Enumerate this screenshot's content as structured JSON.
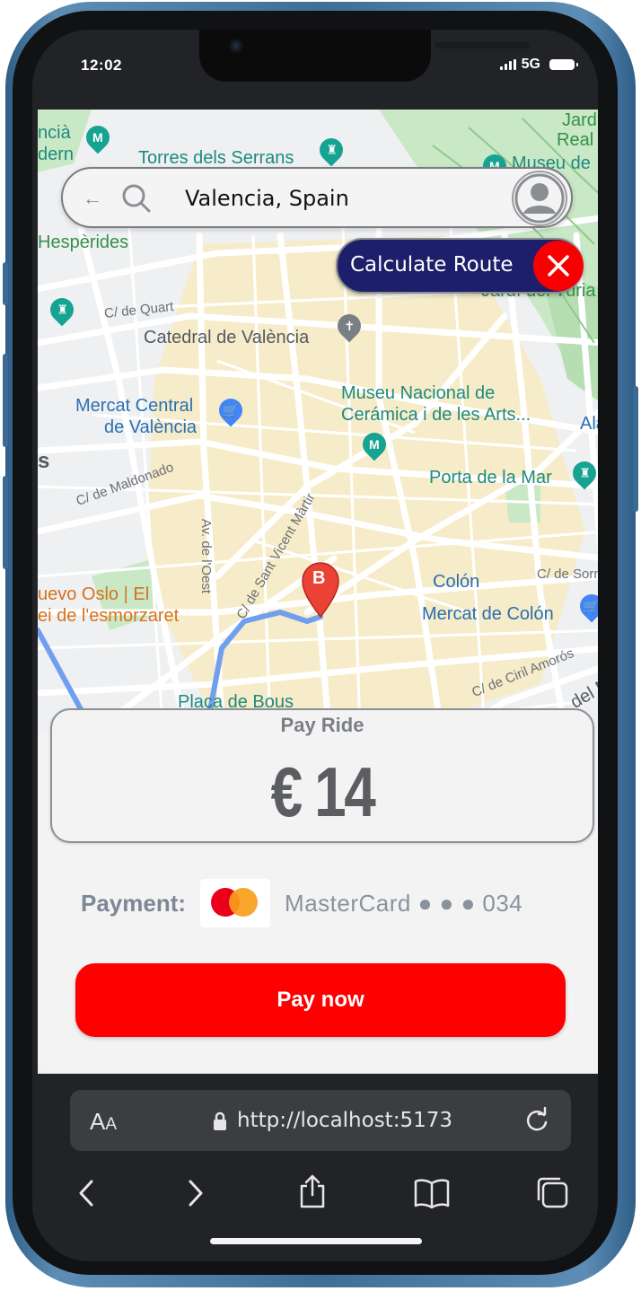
{
  "status": {
    "time": "12:02",
    "network": "5G"
  },
  "search": {
    "query": "Valencia, Spain"
  },
  "route_button": {
    "label": "Calculate Route"
  },
  "map": {
    "labels": {
      "torres": "Torres dels Serrans",
      "museu_belles": "Museu de",
      "jardi_real_1": "Jardi",
      "jardi_real_2": "Real /",
      "hesperides": "Hespèrides",
      "quart": "C/ de Quart",
      "catedral": "Catedral de València",
      "mercat_central_1": "Mercat Central",
      "mercat_central_2": "de València",
      "museu_ceramica_1": "Museu Nacional de",
      "museu_ceramica_2": "Cerámica i de les Arts...",
      "porta_mar": "Porta de la Mar",
      "maldonado": "C/ de Maldonado",
      "oest": "Av. de l'Oest",
      "sant_vicent": "C/ de Sant Vicent Màrtir",
      "colon": "Colón",
      "sorni": "C/ de Sorni",
      "mercat_colon": "Mercat de Colón",
      "nuevo_oslo_1": "uevo Oslo | El",
      "nuevo_oslo_2": "ei de l'esmorzaret",
      "ciril": "C/ de Ciril Amorós",
      "placa_bous": "Plaça de Bous",
      "alameda": "Ala",
      "jardi_turia": "Jardí del Túria",
      "left_cut_1": "ncià",
      "left_cut_2": "dern",
      "del_m": "del M",
      "marker": "B"
    }
  },
  "payment": {
    "title": "Pay Ride",
    "amount": "€ 14",
    "label": "Payment:",
    "card": "MasterCard ● ● ● 034",
    "button": "Pay now"
  },
  "browser": {
    "text_size": "AA",
    "url": "http://localhost:5173"
  },
  "colors": {
    "accent_red": "#fe0000",
    "route_button_bg": "#1e1f6b",
    "route_line": "#6f9ff0"
  },
  "icons": [
    "back-arrow-icon",
    "search-icon",
    "avatar-icon",
    "close-icon",
    "lock-icon",
    "reload-icon",
    "back-icon",
    "forward-icon",
    "share-icon",
    "bookmarks-icon",
    "tabs-icon"
  ]
}
